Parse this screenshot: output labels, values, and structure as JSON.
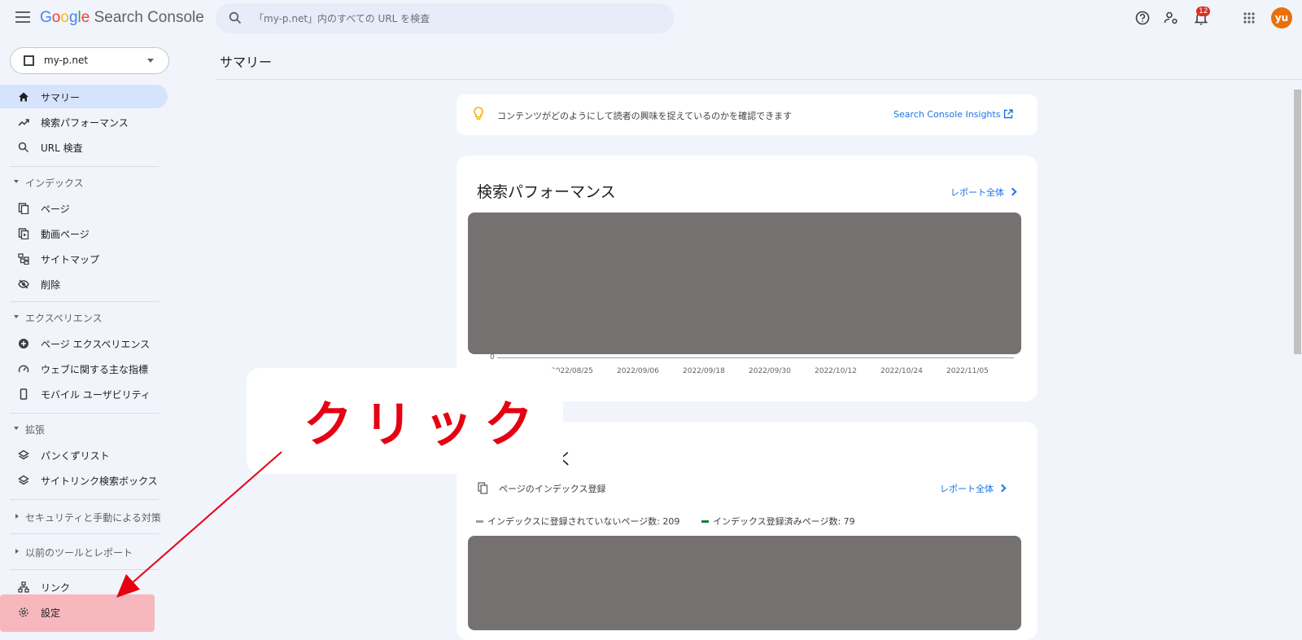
{
  "app": {
    "logo_google": [
      "G",
      "o",
      "o",
      "g",
      "l",
      "e"
    ],
    "logo_product": "Search Console"
  },
  "search": {
    "placeholder": "「my-p.net」内のすべての URL を検査"
  },
  "topbar": {
    "notification_count": "12",
    "avatar_initials": "yu"
  },
  "property": {
    "name": "my-p.net"
  },
  "sidebar": {
    "items": {
      "summary": "サマリー",
      "performance": "検索パフォーマンス",
      "url_inspection": "URL 検査",
      "pages": "ページ",
      "video_pages": "動画ページ",
      "sitemaps": "サイトマップ",
      "removals": "削除",
      "page_experience": "ページ エクスペリエンス",
      "core_web_vitals": "ウェブに関する主な指標",
      "mobile_usability": "モバイル ユーザビリティ",
      "breadcrumbs": "パンくずリスト",
      "sitelinks_searchbox": "サイトリンク検索ボックス",
      "links": "リンク",
      "settings": "設定"
    },
    "sections": {
      "index": "インデックス",
      "experience": "エクスペリエンス",
      "enhancements": "拡張",
      "security": "セキュリティと手動による対策",
      "legacy": "以前のツールとレポート"
    }
  },
  "main": {
    "page_title": "サマリー",
    "insights": {
      "text": "コンテンツがどのようにして読者の興味を捉えているのかを確認できます",
      "link": "Search Console Insights"
    },
    "performance": {
      "title": "検索パフォーマンス",
      "report_link": "レポート全体",
      "y_zero": "0",
      "x_ticks": [
        "2022/08/25",
        "2022/09/06",
        "2022/09/18",
        "2022/09/30",
        "2022/10/12",
        "2022/10/24",
        "2022/11/05"
      ]
    },
    "index": {
      "title_fragment": "く",
      "subtitle": "ページのインデックス登録",
      "report_link": "レポート全体",
      "legend_not_indexed": "インデックスに登録されていないページ数: 209",
      "legend_indexed": "インデックス登録済みページ数: 79",
      "colors": {
        "not_indexed": "#9aa0a6",
        "indexed": "#188038"
      }
    }
  },
  "annotation": {
    "callout": "クリック",
    "color": "#e60012"
  }
}
